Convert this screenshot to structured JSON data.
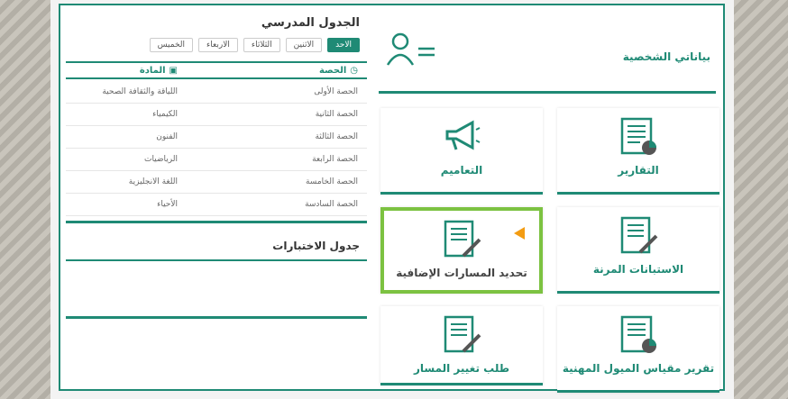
{
  "schedule": {
    "title": "الجدول المدرسي",
    "days": [
      "الاحد",
      "الاثنين",
      "الثلاثاء",
      "الاربعاء",
      "الخميس"
    ],
    "active_day": "الاحد",
    "header_period": "الحصة",
    "header_subject": "المادة",
    "rows": [
      {
        "period": "الحصة الأولى",
        "subject": "اللياقة والثقافة الصحية"
      },
      {
        "period": "الحصة الثانية",
        "subject": "الكيمياء"
      },
      {
        "period": "الحصة الثالثة",
        "subject": "الفنون"
      },
      {
        "period": "الحصة الرابعة",
        "subject": "الرياضيات"
      },
      {
        "period": "الحصة الخامسة",
        "subject": "اللغة الانجليزية"
      },
      {
        "period": "الحصة السادسة",
        "subject": "الأحياء"
      }
    ]
  },
  "exams": {
    "title": "جدول الاختبارات"
  },
  "profile": {
    "title": "بياناتي الشخصية"
  },
  "tiles": {
    "reports": "التقارير",
    "circulars": "التعاميم",
    "surveys": "الاستبانات المرنة",
    "extra_tracks": "تحديد المسارات الإضافية",
    "career_report": "تقرير مقياس الميول المهنية",
    "change_track": "طلب تغيير المسار"
  },
  "colors": {
    "accent": "#1f8a75",
    "highlight": "#7cc241",
    "pointer": "#f39c12"
  }
}
